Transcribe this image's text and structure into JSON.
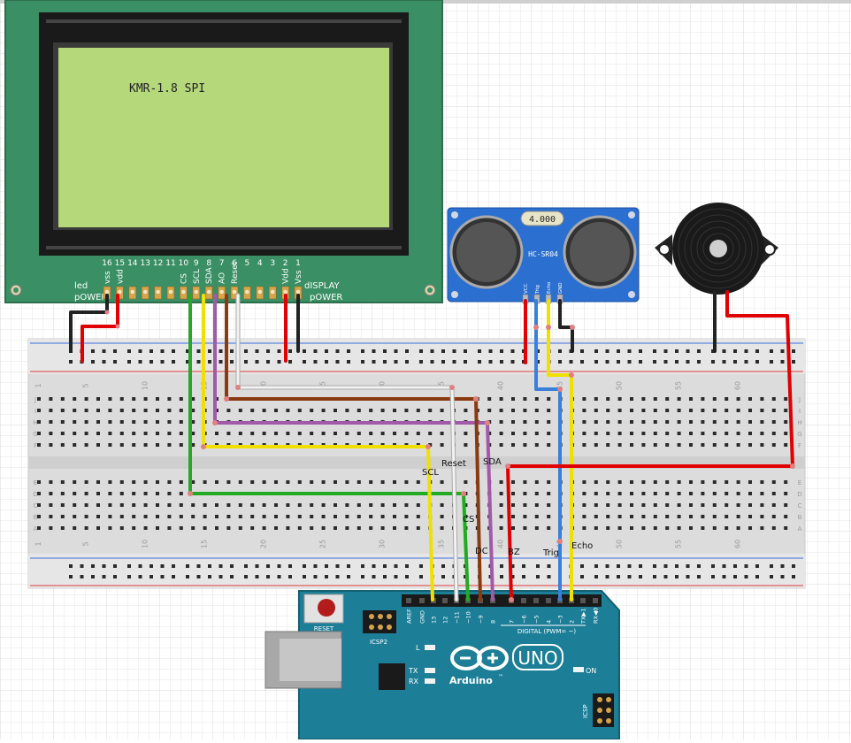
{
  "lcd": {
    "model_text": "KMR-1.8 SPI",
    "pin_numbers": [
      "16",
      "15",
      "14",
      "13",
      "12",
      "11",
      "10",
      "9",
      "8",
      "7",
      "6",
      "5",
      "4",
      "3",
      "2",
      "1"
    ],
    "pin_labels": [
      "vss",
      "vdd",
      "",
      "",
      "",
      "",
      "CS",
      "SCL",
      "SDA",
      "AO",
      "Reset",
      "",
      "",
      "",
      "Vdd",
      "Vss"
    ],
    "led_power_label": [
      "led",
      "pOWER"
    ],
    "display_power_label": [
      "dISPLAY",
      "pOWER"
    ]
  },
  "sensor": {
    "crystal_text": "4.000",
    "model_text": "HC-SR04",
    "pin_labels": [
      "VCC",
      "Trig",
      "Echo",
      "GND"
    ]
  },
  "breadboard": {
    "col_numbers": [
      "1",
      "5",
      "10",
      "15",
      "20",
      "25",
      "30",
      "35",
      "40",
      "45",
      "50",
      "55",
      "60"
    ],
    "row_letters_top": [
      "J",
      "I",
      "H",
      "G",
      "F"
    ],
    "row_letters_bottom": [
      "E",
      "D",
      "C",
      "B",
      "A"
    ]
  },
  "wire_labels": {
    "scl": "SCL",
    "reset": "Reset",
    "sda": "SDA",
    "cs": "CS",
    "dc": "DC",
    "bz": "BZ",
    "trig": "Trig",
    "echo": "Echo"
  },
  "arduino": {
    "reset_label": "RESET",
    "icsp2_label": "ICSP2",
    "icsp_label": "ICSP",
    "brand_text": "Arduino",
    "tm_text": "™",
    "model_text": "UNO",
    "led_l": "L",
    "led_tx": "TX",
    "led_rx": "RX",
    "led_on": "ON",
    "digital_label": "DIGITAL (PWM= ~)",
    "header_pins": [
      "AREF",
      "GND",
      "13",
      "12",
      "~11",
      "~10",
      "~9",
      "8",
      "7",
      "~6",
      "~5",
      "4",
      "~3",
      "2",
      "TX▶1",
      "RX◀0"
    ]
  },
  "colors": {
    "lcd_board": "#3a8f64",
    "lcd_screen": "#b5d87a",
    "sensor_board": "#2b6fd1",
    "arduino_board": "#1c7e97",
    "wire_red": "#e00000",
    "wire_black": "#111111",
    "wire_green": "#22aa22",
    "wire_yellow": "#f0e000",
    "wire_brown": "#8a3a10",
    "wire_purple": "#a05aa8",
    "wire_white": "#eeeeee",
    "wire_blue": "#3a7fd8"
  }
}
